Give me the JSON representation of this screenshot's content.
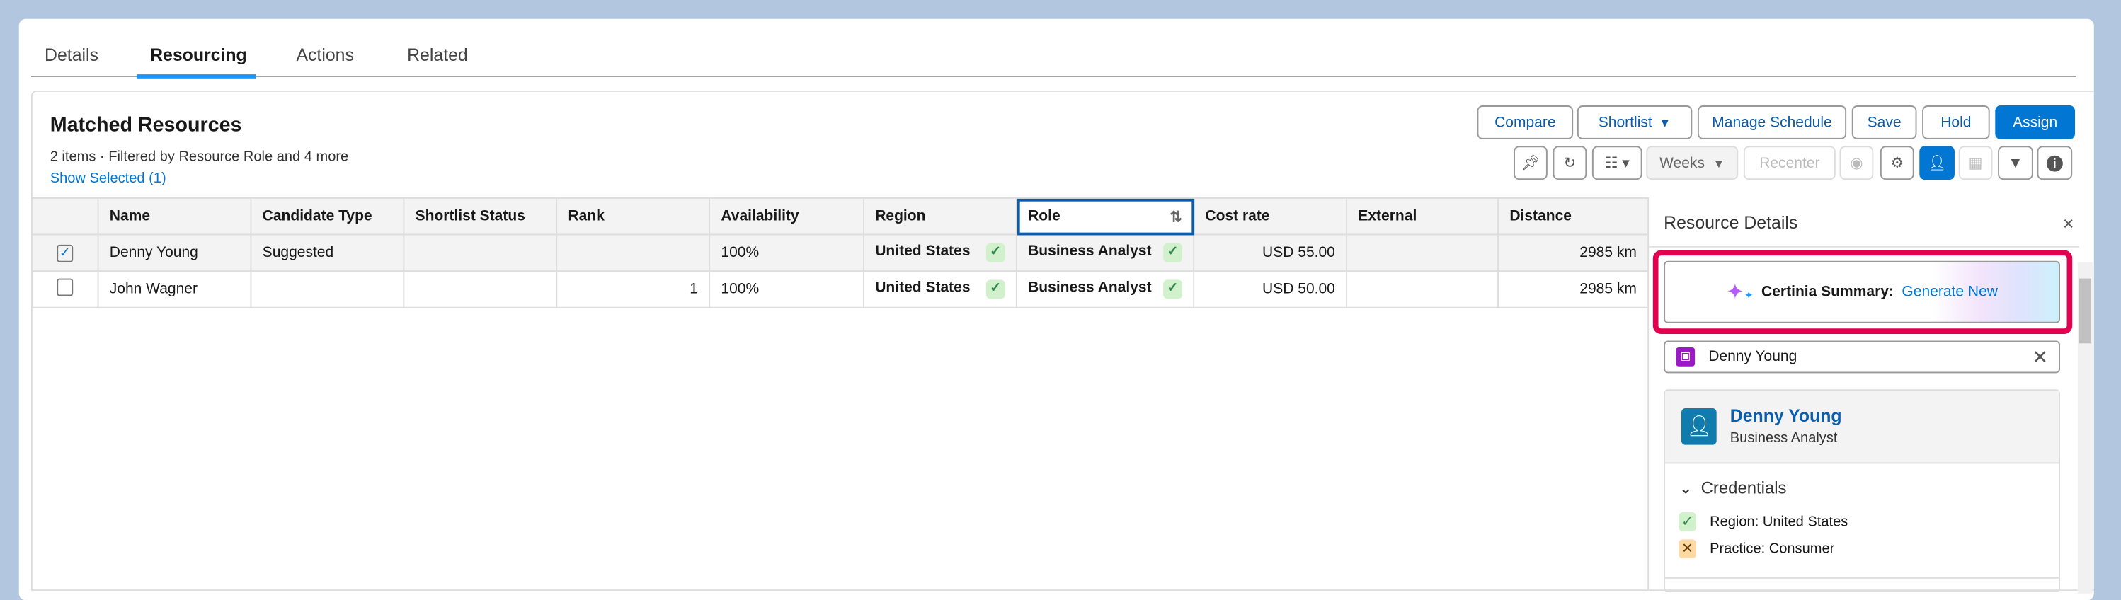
{
  "tabs": [
    {
      "label": "Details"
    },
    {
      "label": "Resourcing",
      "active": true
    },
    {
      "label": "Actions"
    },
    {
      "label": "Related"
    }
  ],
  "header": {
    "title": "Matched Resources",
    "item_count": "2 items",
    "filter_text": "Filtered by Resource Role and 4 more",
    "show_selected": "Show Selected (1)"
  },
  "actions": {
    "compare": "Compare",
    "shortlist": "Shortlist",
    "manage_schedule": "Manage Schedule",
    "save": "Save",
    "hold": "Hold",
    "assign": "Assign"
  },
  "toolbar": {
    "weeks": "Weeks",
    "recenter": "Recenter"
  },
  "table": {
    "columns": [
      "Name",
      "Candidate Type",
      "Shortlist Status",
      "Rank",
      "Availability",
      "Region",
      "Role",
      "Cost rate",
      "External",
      "Distance"
    ],
    "rows": [
      {
        "selected": true,
        "name": "Denny Young",
        "candidate_type": "Suggested",
        "shortlist_status": "",
        "rank": "",
        "availability": "100%",
        "region": "United States",
        "role": "Business Analyst",
        "cost_rate": "USD 55.00",
        "external": "",
        "distance": "2985 km"
      },
      {
        "selected": false,
        "name": "John Wagner",
        "candidate_type": "",
        "shortlist_status": "",
        "rank": "1",
        "availability": "100%",
        "region": "United States",
        "role": "Business Analyst",
        "cost_rate": "USD 50.00",
        "external": "",
        "distance": "2985 km"
      }
    ]
  },
  "panel": {
    "title": "Resource Details",
    "summary_label": "Certinia Summary:",
    "summary_link": "Generate New",
    "selected_resource": "Denny Young",
    "resource": {
      "name": "Denny Young",
      "role": "Business Analyst"
    },
    "credentials_title": "Credentials",
    "credentials": [
      {
        "label": "Region: United States",
        "status": "match"
      },
      {
        "label": "Practice: Consumer",
        "status": "mismatch"
      }
    ]
  },
  "colors": {
    "brand": "#0176d3",
    "highlight": "#e3004f",
    "match": "#2e844a"
  }
}
